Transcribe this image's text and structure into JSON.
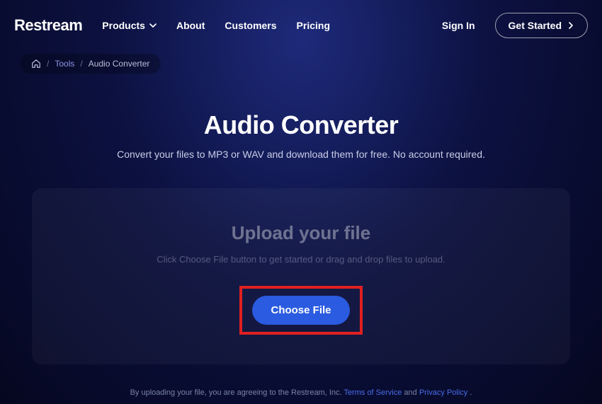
{
  "brand": "Restream",
  "nav": {
    "products": "Products",
    "about": "About",
    "customers": "Customers",
    "pricing": "Pricing",
    "signin": "Sign In",
    "getstarted": "Get Started"
  },
  "breadcrumb": {
    "tools": "Tools",
    "current": "Audio Converter"
  },
  "hero": {
    "title": "Audio Converter",
    "subtitle": "Convert your files to MP3 or WAV and download them for free. No account required."
  },
  "upload": {
    "heading": "Upload your file",
    "hint": "Click Choose File button to get started or drag and drop files to upload.",
    "button": "Choose File"
  },
  "footer": {
    "prefix": "By uploading your file, you are agreeing to the Restream, Inc. ",
    "tos": "Terms of Service",
    "and": " and ",
    "privacy": "Privacy Policy",
    "dot": "."
  }
}
